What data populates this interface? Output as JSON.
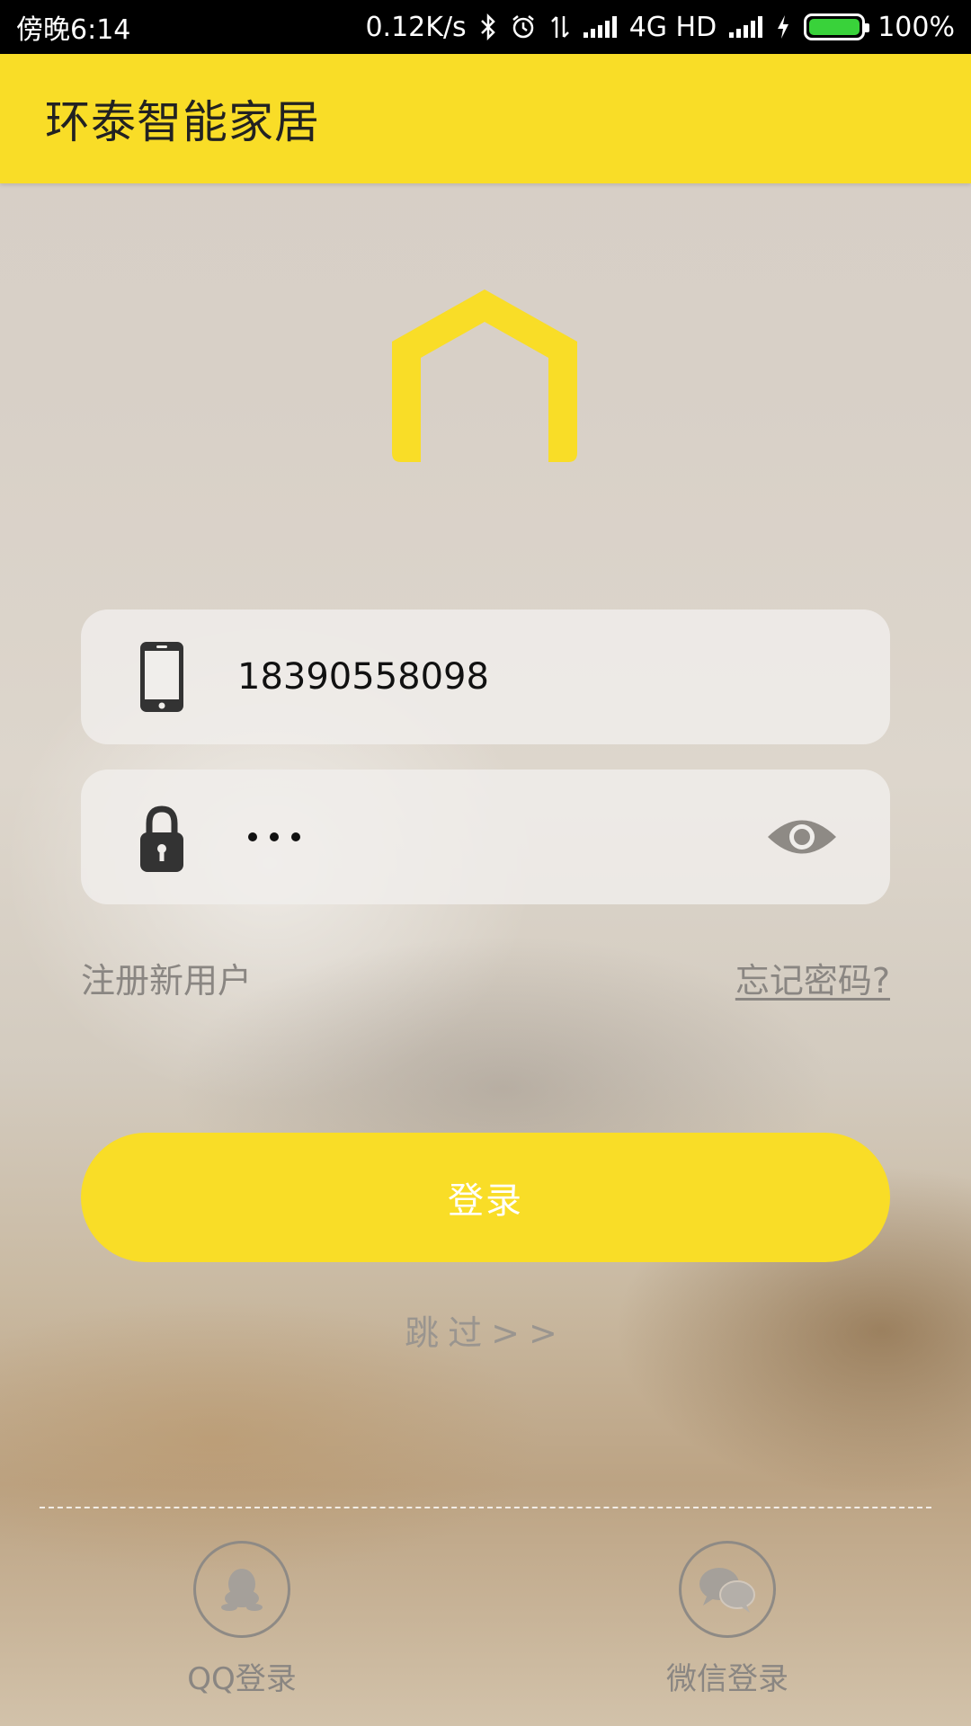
{
  "status_bar": {
    "time": "傍晚6:14",
    "speed": "0.12K/s",
    "network": "4G HD",
    "battery": "100%",
    "battery_level": 1.0
  },
  "app_bar": {
    "title": "环泰智能家居"
  },
  "form": {
    "phone_value": "18390558098",
    "password_masked": "•••",
    "register_label": "注册新用户",
    "forgot_label": "忘记密码?",
    "login_label": "登录",
    "skip_label": "跳过>>"
  },
  "social": {
    "qq_label": "QQ登录",
    "wechat_label": "微信登录"
  },
  "colors": {
    "accent": "#f9dd27",
    "status_bar": "#000000",
    "muted_text": "#8a8682",
    "icon_dark": "#333333"
  },
  "icons": [
    "bluetooth-icon",
    "alarm-icon",
    "data-arrows-icon",
    "signal-icon",
    "charging-icon",
    "battery-icon",
    "house-logo-icon",
    "phone-icon",
    "lock-icon",
    "eye-icon",
    "qq-icon",
    "wechat-icon"
  ]
}
